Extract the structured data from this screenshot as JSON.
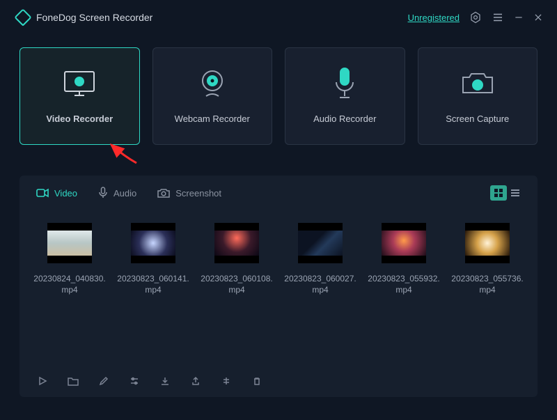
{
  "app_title": "FoneDog Screen Recorder",
  "titlebar": {
    "unregistered": "Unregistered"
  },
  "modes": {
    "video": "Video Recorder",
    "webcam": "Webcam Recorder",
    "audio": "Audio Recorder",
    "capture": "Screen Capture",
    "active": "video"
  },
  "panel": {
    "tabs": {
      "video": "Video",
      "audio": "Audio",
      "screenshot": "Screenshot",
      "active": "video"
    },
    "view": "grid"
  },
  "files": {
    "0": "20230824_040830.mp4",
    "1": "20230823_060141.mp4",
    "2": "20230823_060108.mp4",
    "3": "20230823_060027.mp4",
    "4": "20230823_055932.mp4",
    "5": "20230823_055736.mp4"
  }
}
